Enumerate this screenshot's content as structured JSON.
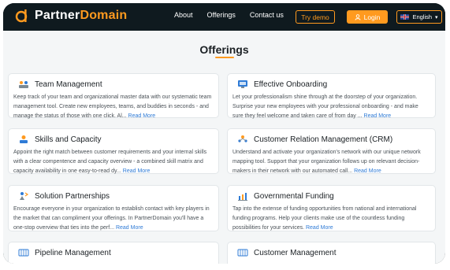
{
  "brand": {
    "name_part1": "Partner",
    "name_part2": "Domain",
    "accent": "#ff9a1f"
  },
  "nav": {
    "links": [
      "About",
      "Offerings",
      "Contact us"
    ],
    "demo_label": "Try demo",
    "login_label": "Login",
    "language_label": "English"
  },
  "page": {
    "title": "Offerings"
  },
  "cards": [
    {
      "title": "Team Management",
      "icon": "team-icon",
      "desc": "Keep track of your team and organizational master data with our systematic team management tool. Create new employees, teams, and buddies in seconds - and manage the status of those with one click. Al...",
      "link": "Read More"
    },
    {
      "title": "Effective Onboarding",
      "icon": "onboarding-icon",
      "desc": "Let your professionalism shine through at the doorstep of your organization. Surprise your new employees with your professional onboarding - and make sure they feel welcome and taken care of from day ...",
      "link": "Read More"
    },
    {
      "title": "Skills and Capacity",
      "icon": "skills-icon",
      "desc": "Appoint the right match between customer requirements and your internal skills with a clear compentence and capacity overview - a combined skill matrix and capacity availability in one easy-to-read dy...",
      "link": "Read More"
    },
    {
      "title": "Customer Relation Management (CRM)",
      "icon": "crm-icon",
      "desc": "Understand and activate your organization's network with our unique network mapping tool. Support that your organization follows up on relevant decision-makers in their network with our automated call...",
      "link": "Read More"
    },
    {
      "title": "Solution Partnerships",
      "icon": "partnership-icon",
      "desc": "Encourage everyone in your organization to establish contact with key players in the market that can compliment your offerings. In PartnerDomain you'll have a one-stop overview that ties into the perf...",
      "link": "Read More"
    },
    {
      "title": "Governmental Funding",
      "icon": "funding-icon",
      "desc": "Tap into the extense of funding opportunities from national and international funding programs. Help your clients make use of the countless funding possibilities for your services.",
      "link": "Read More"
    },
    {
      "title": "Pipeline Management",
      "icon": "pipeline-icon",
      "desc": "",
      "link": ""
    },
    {
      "title": "Customer Management",
      "icon": "customer-icon",
      "desc": "",
      "link": ""
    }
  ]
}
